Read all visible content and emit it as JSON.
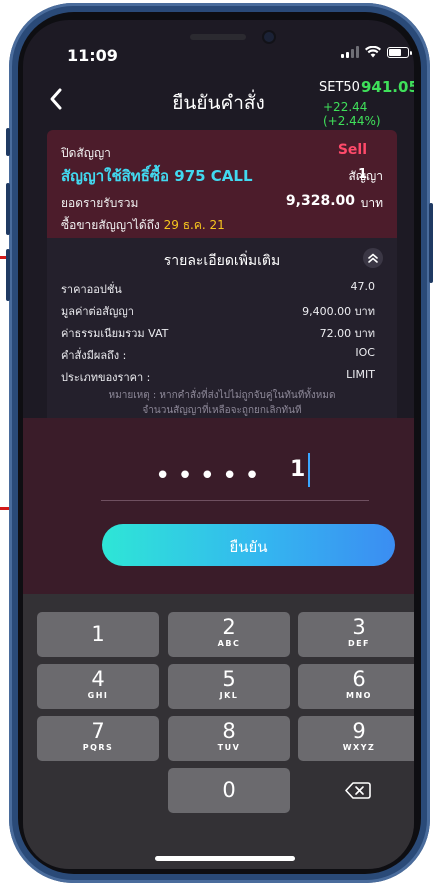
{
  "status": {
    "time": "11:09"
  },
  "header": {
    "title": "ยืนยันคำสั่ง",
    "index_name": "SET50",
    "index_value": "941.05",
    "index_change": "+22.44 (+2.44%)"
  },
  "order": {
    "position_label": "ปิดสัญญา",
    "side": "Sell",
    "contract": "สัญญาใช้สิทธิ์ซื้อ 975 CALL",
    "qty": "1",
    "qty_unit": "สัญญา",
    "total_label": "ยอดรายรับรวม",
    "total_value": "9,328.00",
    "total_unit": "บาท",
    "trade_until_label": "ซื้อขายสัญญาได้ถึง",
    "trade_until_date": "29 ธ.ค. 21"
  },
  "details": {
    "title": "รายละเอียดเพิ่มเติม",
    "rows": [
      {
        "label": "ราคาออปชั่น",
        "value": "47.0"
      },
      {
        "label": "มูลค่าต่อสัญญา",
        "value": "9,400.00 บาท"
      },
      {
        "label": "ค่าธรรมเนียมรวม VAT",
        "value": "72.00 บาท"
      },
      {
        "label": "คำสั่งมีผลถึง :",
        "value": "IOC"
      },
      {
        "label": "ประเภทของราคา :",
        "value": "LIMIT"
      }
    ],
    "note_line1": "หมายเหตุ : หากคำสั่งที่ส่งไปไม่ถูกจับคู่ในทันทีทั้งหมด",
    "note_line2": "จำนวนสัญญาที่เหลือจะถูกยกเลิกทันที"
  },
  "pin": {
    "masked": "•••••",
    "last_digit": "1"
  },
  "confirm_label": "ยืนยัน",
  "keypad": {
    "keys": [
      {
        "digit": "1",
        "letters": ""
      },
      {
        "digit": "2",
        "letters": "ABC"
      },
      {
        "digit": "3",
        "letters": "DEF"
      },
      {
        "digit": "4",
        "letters": "GHI"
      },
      {
        "digit": "5",
        "letters": "JKL"
      },
      {
        "digit": "6",
        "letters": "MNO"
      },
      {
        "digit": "7",
        "letters": "PQRS"
      },
      {
        "digit": "8",
        "letters": "TUV"
      },
      {
        "digit": "9",
        "letters": "WXYZ"
      },
      {
        "digit": "0",
        "letters": ""
      }
    ],
    "delete_icon": "backspace-icon"
  },
  "colors": {
    "sell": "#ff4a6a",
    "contract": "#42d9f0",
    "index_up": "#3fe05a",
    "date": "#f6c51e",
    "annotation": "#d31a1a"
  }
}
